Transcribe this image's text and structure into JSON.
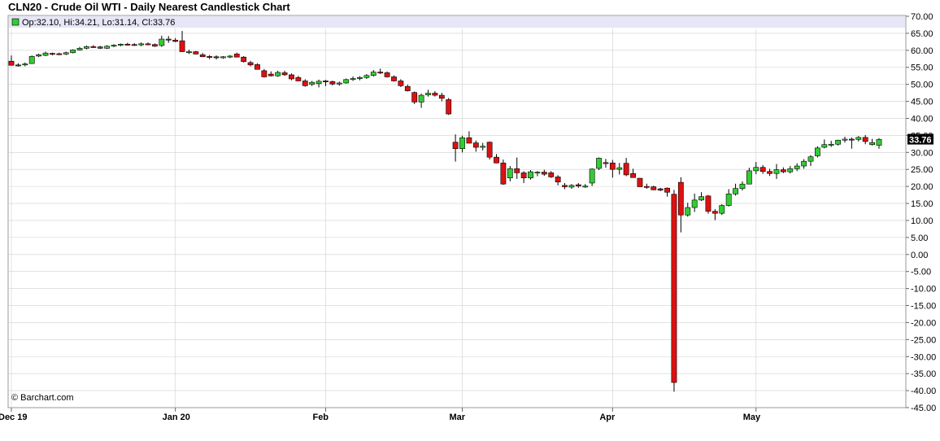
{
  "chart_data": {
    "type": "candlestick",
    "title": "CLN20 - Crude Oil WTI - Daily Nearest Candlestick Chart",
    "ohlc_label": "Op:32.10, Hi:34.21, Lo:31.14, Cl:33.76",
    "credit": "© Barchart.com",
    "last_price": "33.76",
    "ylim": [
      -45,
      70
    ],
    "y_ticks": [
      "70.00",
      "65.00",
      "60.00",
      "55.00",
      "50.00",
      "45.00",
      "40.00",
      "35.00",
      "30.00",
      "25.00",
      "20.00",
      "15.00",
      "10.00",
      "5.00",
      "0.00",
      "-5.00",
      "-10.00",
      "-15.00",
      "-20.00",
      "-25.00",
      "-30.00",
      "-35.00",
      "-40.00",
      "-45.00"
    ],
    "x_labels": [
      {
        "label": "Dec 19",
        "index": 0
      },
      {
        "label": "Jan 20",
        "index": 24
      },
      {
        "label": "Feb",
        "index": 46
      },
      {
        "label": "Mar",
        "index": 66
      },
      {
        "label": "Apr",
        "index": 88
      },
      {
        "label": "May",
        "index": 109
      }
    ],
    "candles": [
      [
        56.8,
        58.5,
        55.5,
        55.6
      ],
      [
        55.7,
        56.2,
        55.2,
        55.6
      ],
      [
        55.7,
        56.4,
        55.3,
        56.0
      ],
      [
        56.1,
        58.5,
        56.0,
        58.2
      ],
      [
        58.3,
        59.0,
        58.0,
        58.7
      ],
      [
        58.5,
        59.6,
        58.3,
        59.2
      ],
      [
        59.1,
        59.3,
        58.5,
        59.0
      ],
      [
        59.0,
        59.3,
        58.6,
        58.9
      ],
      [
        58.9,
        59.6,
        58.6,
        59.3
      ],
      [
        59.3,
        60.3,
        59.1,
        60.1
      ],
      [
        60.1,
        61.0,
        59.9,
        60.6
      ],
      [
        60.6,
        61.4,
        60.3,
        61.1
      ],
      [
        61.1,
        61.5,
        60.7,
        61.0
      ],
      [
        61.0,
        61.3,
        60.4,
        60.6
      ],
      [
        60.6,
        61.5,
        60.4,
        61.2
      ],
      [
        61.2,
        61.8,
        60.9,
        61.5
      ],
      [
        61.5,
        62.0,
        61.2,
        61.8
      ],
      [
        61.8,
        62.2,
        61.4,
        61.7
      ],
      [
        61.7,
        62.1,
        61.3,
        61.6
      ],
      [
        61.6,
        62.3,
        61.2,
        61.9
      ],
      [
        61.9,
        62.3,
        61.5,
        61.7
      ],
      [
        61.7,
        62.0,
        61.0,
        61.2
      ],
      [
        61.4,
        64.3,
        61.0,
        63.3
      ],
      [
        63.3,
        64.2,
        62.2,
        63.0
      ],
      [
        63.0,
        63.6,
        62.4,
        62.6
      ],
      [
        62.8,
        65.7,
        59.5,
        59.6
      ],
      [
        59.6,
        60.2,
        58.9,
        59.6
      ],
      [
        59.6,
        59.8,
        58.8,
        58.9
      ],
      [
        58.7,
        59.2,
        58.1,
        58.1
      ],
      [
        58.2,
        58.6,
        57.4,
        58.1
      ],
      [
        58.1,
        58.5,
        57.3,
        57.8
      ],
      [
        57.8,
        58.3,
        57.5,
        58.1
      ],
      [
        58.1,
        58.6,
        57.7,
        58.3
      ],
      [
        58.9,
        59.3,
        57.9,
        58.0
      ],
      [
        58.0,
        58.3,
        56.4,
        56.7
      ],
      [
        56.4,
        56.9,
        55.3,
        55.7
      ],
      [
        55.8,
        56.2,
        54.8,
        54.4
      ],
      [
        54.0,
        54.5,
        52.0,
        52.2
      ],
      [
        53.0,
        53.8,
        52.3,
        52.5
      ],
      [
        52.5,
        54.0,
        52.2,
        53.5
      ],
      [
        53.4,
        54.0,
        52.5,
        52.8
      ],
      [
        52.8,
        53.2,
        51.2,
        51.6
      ],
      [
        52.0,
        52.5,
        50.9,
        51.0
      ],
      [
        51.0,
        51.5,
        49.3,
        49.6
      ],
      [
        50.0,
        51.0,
        49.5,
        50.6
      ],
      [
        50.2,
        51.4,
        49.1,
        50.9
      ],
      [
        51.0,
        51.3,
        49.5,
        50.8
      ],
      [
        50.8,
        51.1,
        49.7,
        50.1
      ],
      [
        50.1,
        50.8,
        49.6,
        50.4
      ],
      [
        50.4,
        51.7,
        50.2,
        51.4
      ],
      [
        51.4,
        52.3,
        51.0,
        51.7
      ],
      [
        51.7,
        52.4,
        51.2,
        52.0
      ],
      [
        52.0,
        53.0,
        51.6,
        52.6
      ],
      [
        52.6,
        54.2,
        52.3,
        53.6
      ],
      [
        53.6,
        54.6,
        53.0,
        53.4
      ],
      [
        53.4,
        53.8,
        52.0,
        52.2
      ],
      [
        52.2,
        52.6,
        50.8,
        51.0
      ],
      [
        51.0,
        51.5,
        49.2,
        49.6
      ],
      [
        49.4,
        49.9,
        47.9,
        48.1
      ],
      [
        47.6,
        47.9,
        44.2,
        44.8
      ],
      [
        44.8,
        47.3,
        43.1,
        46.8
      ],
      [
        46.9,
        48.4,
        46.4,
        47.4
      ],
      [
        47.4,
        48.0,
        46.4,
        46.8
      ],
      [
        46.8,
        47.5,
        45.0,
        45.9
      ],
      [
        45.5,
        46.0,
        41.0,
        41.3
      ],
      [
        33.0,
        35.3,
        27.3,
        31.1
      ],
      [
        31.1,
        34.9,
        30.0,
        34.3
      ],
      [
        34.3,
        36.2,
        32.8,
        32.7
      ],
      [
        32.8,
        33.5,
        30.2,
        31.5
      ],
      [
        31.5,
        32.8,
        30.6,
        31.8
      ],
      [
        33.0,
        33.2,
        27.9,
        28.6
      ],
      [
        28.6,
        29.5,
        26.8,
        26.9
      ],
      [
        26.9,
        27.9,
        20.5,
        20.7
      ],
      [
        22.5,
        26.0,
        21.5,
        25.2
      ],
      [
        25.2,
        28.5,
        22.2,
        24.0
      ],
      [
        24.0,
        24.5,
        21.0,
        22.5
      ],
      [
        22.5,
        24.8,
        22.0,
        24.3
      ],
      [
        24.0,
        24.5,
        23.0,
        24.2
      ],
      [
        24.2,
        24.9,
        23.1,
        23.6
      ],
      [
        24.0,
        24.5,
        22.5,
        22.8
      ],
      [
        22.8,
        23.3,
        20.3,
        21.3
      ],
      [
        20.3,
        21.0,
        19.2,
        19.9
      ],
      [
        19.8,
        20.7,
        19.3,
        20.3
      ],
      [
        20.5,
        21.0,
        19.6,
        20.1
      ],
      [
        20.1,
        20.7,
        19.6,
        20.1
      ],
      [
        21.0,
        25.3,
        20.1,
        25.1
      ],
      [
        25.3,
        28.5,
        24.8,
        28.3
      ],
      [
        27.0,
        28.1,
        25.5,
        26.8
      ],
      [
        26.9,
        27.8,
        22.6,
        25.0
      ],
      [
        25.0,
        26.9,
        23.5,
        25.5
      ],
      [
        26.8,
        28.4,
        23.0,
        23.4
      ],
      [
        23.8,
        25.2,
        22.6,
        22.6
      ],
      [
        22.4,
        22.5,
        19.9,
        19.9
      ],
      [
        20.0,
        20.8,
        19.3,
        19.9
      ],
      [
        19.9,
        20.2,
        18.9,
        19.0
      ],
      [
        19.3,
        19.6,
        18.6,
        18.9
      ],
      [
        19.5,
        19.7,
        17.0,
        18.3
      ],
      [
        17.7,
        19.0,
        -40.3,
        -37.6
      ],
      [
        21.2,
        22.7,
        6.5,
        11.6
      ],
      [
        11.6,
        15.2,
        11.1,
        13.8
      ],
      [
        13.8,
        17.9,
        12.5,
        16.0
      ],
      [
        16.0,
        18.3,
        15.7,
        17.0
      ],
      [
        17.2,
        17.5,
        12.0,
        12.7
      ],
      [
        12.7,
        13.3,
        10.1,
        12.1
      ],
      [
        12.1,
        14.8,
        11.6,
        14.4
      ],
      [
        14.4,
        19.2,
        14.1,
        17.8
      ],
      [
        17.8,
        20.8,
        17.3,
        19.4
      ],
      [
        19.4,
        21.5,
        18.8,
        20.7
      ],
      [
        20.7,
        25.5,
        20.6,
        24.6
      ],
      [
        24.6,
        27.2,
        23.6,
        25.6
      ],
      [
        25.6,
        26.3,
        23.7,
        24.4
      ],
      [
        24.4,
        25.2,
        23.1,
        23.8
      ],
      [
        23.8,
        26.6,
        22.2,
        24.9
      ],
      [
        24.9,
        25.6,
        23.9,
        24.3
      ],
      [
        24.3,
        26.0,
        23.8,
        25.2
      ],
      [
        25.2,
        26.8,
        24.5,
        26.0
      ],
      [
        26.0,
        28.0,
        25.2,
        27.4
      ],
      [
        27.4,
        29.2,
        26.0,
        28.7
      ],
      [
        29.0,
        31.8,
        28.5,
        31.3
      ],
      [
        31.5,
        33.8,
        31.2,
        32.3
      ],
      [
        32.3,
        33.4,
        31.6,
        32.4
      ],
      [
        32.4,
        33.7,
        32.0,
        33.6
      ],
      [
        33.6,
        34.6,
        32.9,
        33.9
      ],
      [
        33.9,
        34.4,
        31.1,
        33.8
      ],
      [
        33.8,
        34.8,
        33.2,
        34.4
      ],
      [
        34.4,
        35.1,
        32.4,
        33.2
      ],
      [
        32.3,
        34.0,
        32.0,
        32.9
      ],
      [
        32.1,
        34.2,
        31.1,
        33.8
      ]
    ]
  },
  "colors": {
    "up": "#33cc33",
    "down": "#dd1111",
    "wick": "#000000",
    "grid": "#d0d0d0",
    "info_bg": "#e6e6f7",
    "last_bg": "#000000"
  }
}
